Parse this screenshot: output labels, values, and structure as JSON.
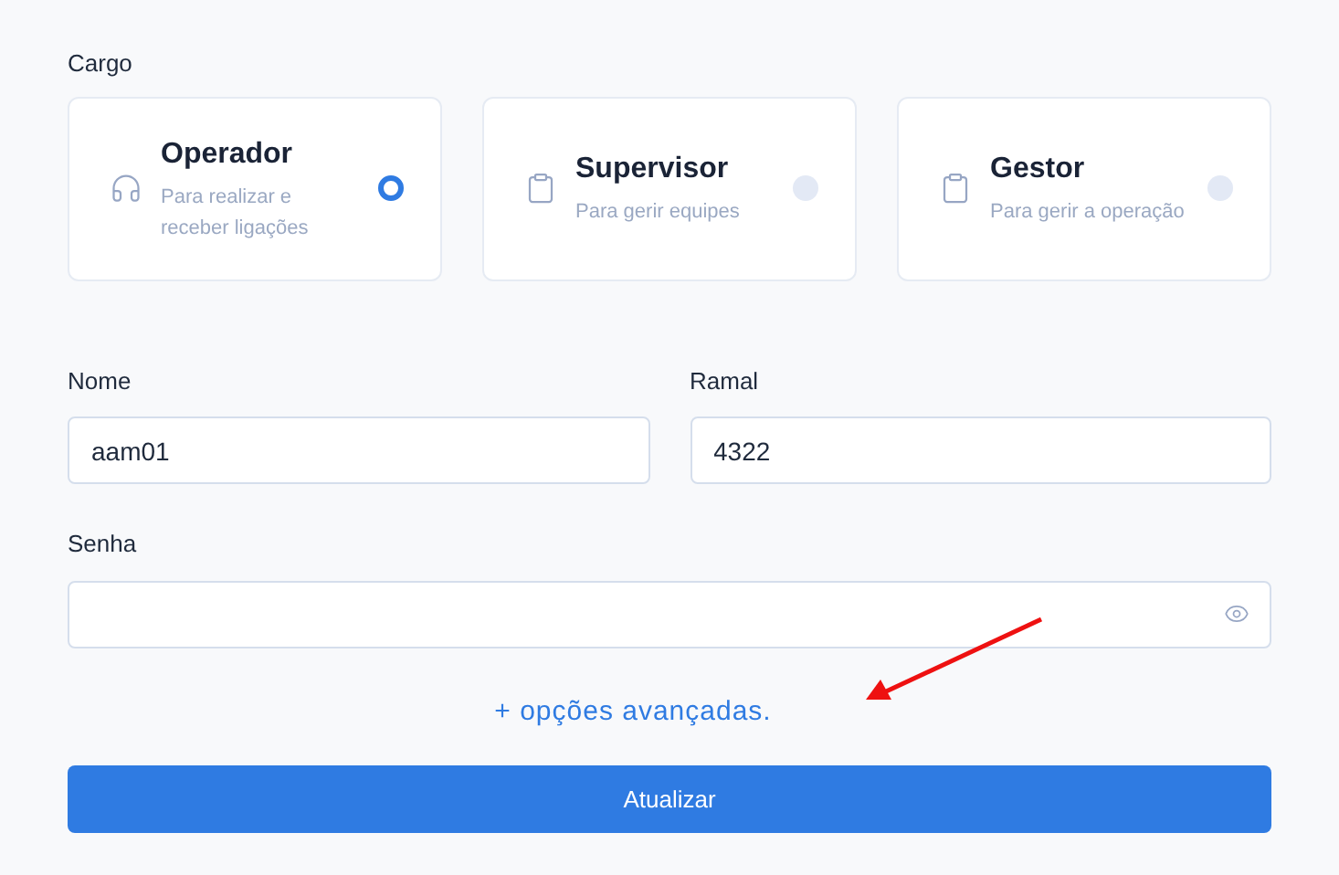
{
  "role_label": "Cargo",
  "roles": [
    {
      "title": "Operador",
      "description": "Para realizar e receber ligações",
      "kind": "headset",
      "selected": true
    },
    {
      "title": "Supervisor",
      "description": "Para gerir equipes",
      "kind": "clipboard",
      "selected": false
    },
    {
      "title": "Gestor",
      "description": "Para gerir a operação",
      "kind": "clipboard",
      "selected": false
    }
  ],
  "name_field": {
    "label": "Nome",
    "value": "aam01"
  },
  "extension_field": {
    "label": "Ramal",
    "value": "4322"
  },
  "password_field": {
    "label": "Senha"
  },
  "advanced_link": "+ opções avançadas.",
  "submit_button": "Atualizar"
}
